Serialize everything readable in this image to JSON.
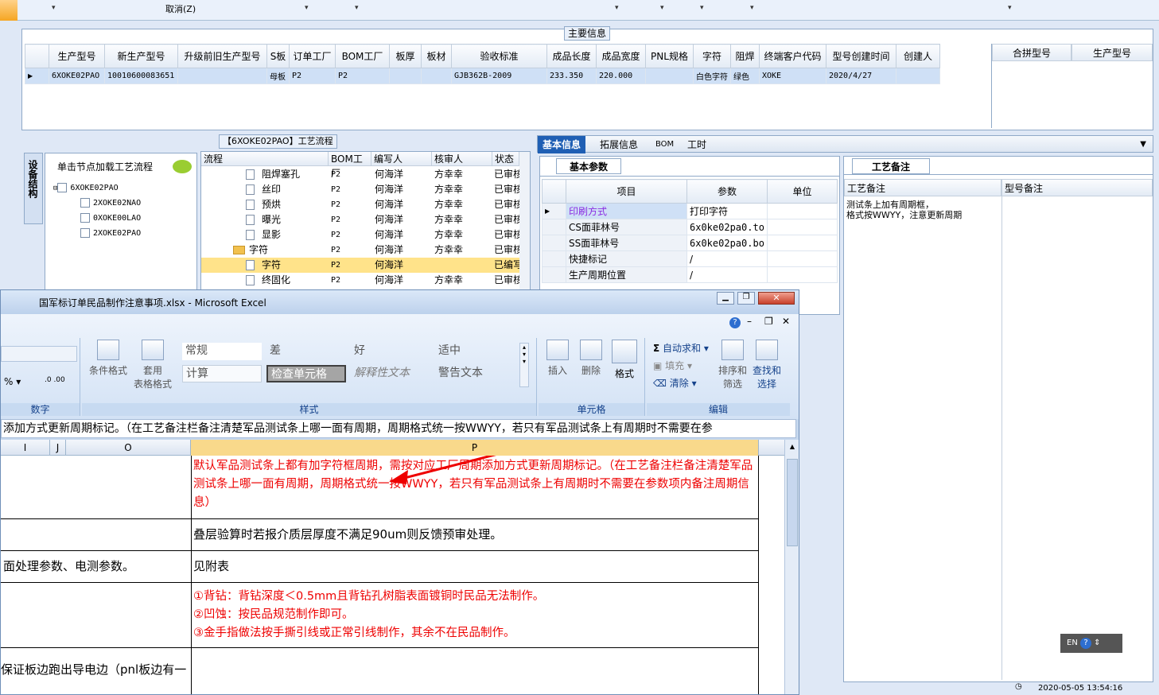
{
  "top_bar": {
    "cancel_label": "取消(Z)"
  },
  "main_info": {
    "panel_title": "主要信息",
    "columns": [
      "生产型号",
      "新生产型号",
      "升级前旧生产型号",
      "S板",
      "订单工厂",
      "BOM工厂",
      "板厚",
      "板材",
      "验收标准",
      "成品长度",
      "成品宽度",
      "PNL规格",
      "字符",
      "阻焊",
      "终端客户代码",
      "型号创建时间",
      "创建人"
    ],
    "row": [
      "6XOKE02PAO",
      "10010600083651",
      "",
      "母板",
      "P2",
      "P2",
      "",
      "",
      "GJB362B-2009",
      "233.350",
      "220.000",
      "",
      "白色字符",
      "绿色",
      "XOKE",
      "2020/4/27",
      ""
    ],
    "side_columns": [
      "合拼型号",
      "生产型号"
    ]
  },
  "device_panel": {
    "tab_label": "设备结构",
    "header": "单击节点加载工艺流程",
    "root": "6XOKE02PAO",
    "children": [
      "2XOKE02NAO",
      "0XOKE00LAO",
      "2XOKE02PAO"
    ]
  },
  "flow_panel": {
    "title": "【6XOKE02PAO】工艺流程",
    "columns": [
      "流程",
      "BOM工厂",
      "编写人",
      "核审人",
      "状态"
    ],
    "rows": [
      {
        "name": "阻焊塞孔",
        "bom": "P2",
        "writer": "何海洋",
        "reviewer": "方幸幸",
        "status": "已审核"
      },
      {
        "name": "丝印",
        "bom": "P2",
        "writer": "何海洋",
        "reviewer": "方幸幸",
        "status": "已审核"
      },
      {
        "name": "预烘",
        "bom": "P2",
        "writer": "何海洋",
        "reviewer": "方幸幸",
        "status": "已审核"
      },
      {
        "name": "曝光",
        "bom": "P2",
        "writer": "何海洋",
        "reviewer": "方幸幸",
        "status": "已审核"
      },
      {
        "name": "显影",
        "bom": "P2",
        "writer": "何海洋",
        "reviewer": "方幸幸",
        "status": "已审核"
      },
      {
        "name": "字符",
        "bom": "P2",
        "writer": "何海洋",
        "reviewer": "方幸幸",
        "status": "已审核"
      },
      {
        "name": "字符",
        "bom": "P2",
        "writer": "何海洋",
        "reviewer": "",
        "status": "已编写"
      },
      {
        "name": "终固化",
        "bom": "P2",
        "writer": "何海洋",
        "reviewer": "方幸幸",
        "status": "已审核"
      }
    ]
  },
  "right_tabs": [
    "基本信息",
    "拓展信息",
    "BOM",
    "工时"
  ],
  "basic_params": {
    "tab": "基本参数",
    "columns": [
      "项目",
      "参数",
      "单位"
    ],
    "rows": [
      {
        "item": "印刷方式",
        "value": "打印字符"
      },
      {
        "item": "CS面菲林号",
        "value": "6x0ke02pa0.to"
      },
      {
        "item": "SS面菲林号",
        "value": "6x0ke02pa0.bo"
      },
      {
        "item": "快捷标记",
        "value": "/"
      },
      {
        "item": "生产周期位置",
        "value": "/"
      }
    ]
  },
  "process_note": {
    "tab": "工艺备注",
    "col1": "工艺备注",
    "col2": "型号备注",
    "text1": "测试条上加有周期框，",
    "text2": "格式按WWYY，注意更新周期"
  },
  "excel": {
    "title": "国军标订单民品制作注意事项.xlsx - Microsoft Excel",
    "styles": [
      "常规",
      "差",
      "好",
      "适中",
      "计算",
      "检查单元格",
      "解释性文本",
      "警告文本"
    ],
    "buttons": {
      "cond_format": "条件格式",
      "table_format_1": "套用",
      "table_format_2": "表格格式",
      "insert": "插入",
      "delete": "删除",
      "format": "格式",
      "autosum": "自动求和",
      "fill": "填充",
      "clear": "清除",
      "sort_1": "排序和",
      "sort_2": "筛选",
      "find_1": "查找和",
      "find_2": "选择"
    },
    "groups": [
      "数字",
      "样式",
      "单元格",
      "编辑"
    ],
    "formula_text": "添加方式更新周期标记。（在工艺备注栏备注清楚军品测试条上哪一面有周期，周期格式统一按WWYY，若只有军品测试条上有周期时不需要在参",
    "col_headers": [
      "I",
      "J",
      "O",
      "P"
    ],
    "cells": {
      "p1": "默认军品测试条上都有加字符框周期，需按对应工厂周期添加方式更新周期标记。（在工艺备注栏备注清楚军品测试条上哪一面有周期，周期格式统一按WWYY，若只有军品测试条上有周期时不需要在参数项内备注周期信息）",
      "p2": "叠层验算时若报介质层厚度不满足90um则反馈预审处理。",
      "o3": "面处理参数、电测参数。",
      "p3": "见附表",
      "p4a": "①背钻：背钻深度＜0.5mm且背钻孔树脂表面镀铜时民品无法制作。",
      "p4b": "②凹蚀：按民品规范制作即可。",
      "p4c": "③金手指做法按手撕引线或正常引线制作，其余不在民品制作。",
      "o5": "保证板边跑出导电边（pnl板边有一"
    }
  },
  "tray": {
    "lang": "EN"
  },
  "status": {
    "time": "2020-05-05 13:54:16"
  },
  "colors": {
    "accent": "#15428b",
    "red": "#e00000",
    "selected_row": "#cfe0f6",
    "highlight": "#ffe38a"
  }
}
